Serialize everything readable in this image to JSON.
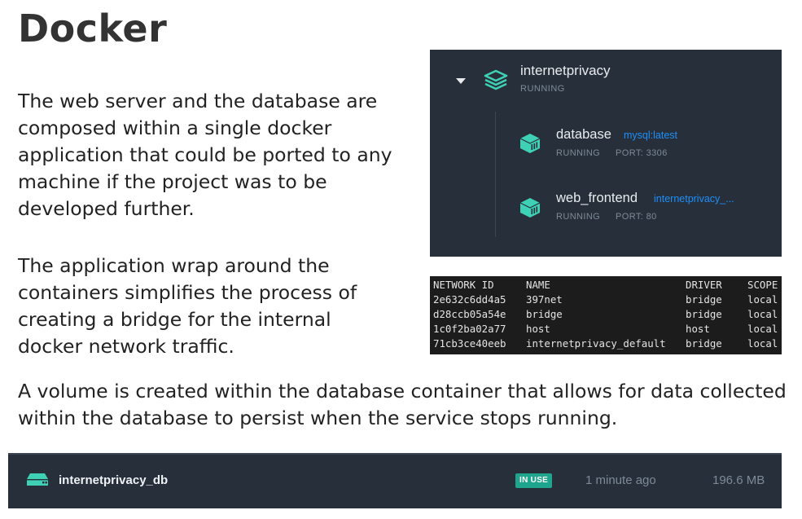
{
  "title": "Docker",
  "paragraphs": {
    "p1": "The web server and the database are composed within a single docker application that could be ported to any machine if the project was to be developed further.",
    "p2": "The application wrap around the containers simplifies the process of creating a bridge for the internal docker network traffic.",
    "p3": "A volume is created within the database container that allows for data collected within the database to persist when the service stops running."
  },
  "app": {
    "name": "internetprivacy",
    "status": "RUNNING",
    "containers": [
      {
        "name": "database",
        "image": "mysql:latest",
        "status": "RUNNING",
        "port": "PORT: 3306",
        "icon": "container-icon"
      },
      {
        "name": "web_frontend",
        "image": "internetprivacy_...",
        "status": "RUNNING",
        "port": "PORT: 80",
        "icon": "container-icon"
      }
    ]
  },
  "network": {
    "headers": [
      "NETWORK ID",
      "NAME",
      "DRIVER",
      "SCOPE"
    ],
    "rows": [
      [
        "2e632c6dd4a5",
        "397net",
        "bridge",
        "local"
      ],
      [
        "d28ccb05a54e",
        "bridge",
        "bridge",
        "local"
      ],
      [
        "1c0f2ba02a77",
        "host",
        "host",
        "local"
      ],
      [
        "71cb3ce40eeb",
        "internetprivacy_default",
        "bridge",
        "local"
      ]
    ]
  },
  "volume": {
    "name": "internetprivacy_db",
    "badge": "IN USE",
    "time": "1 minute ago",
    "size": "196.6 MB",
    "icon": "disk-icon"
  },
  "colors": {
    "panel_bg": "#27303a",
    "accent_teal": "#3fd1b5",
    "link_blue": "#1d8ffb",
    "badge_green": "#1fa58e",
    "terminal_bg": "#1c1c1c"
  }
}
